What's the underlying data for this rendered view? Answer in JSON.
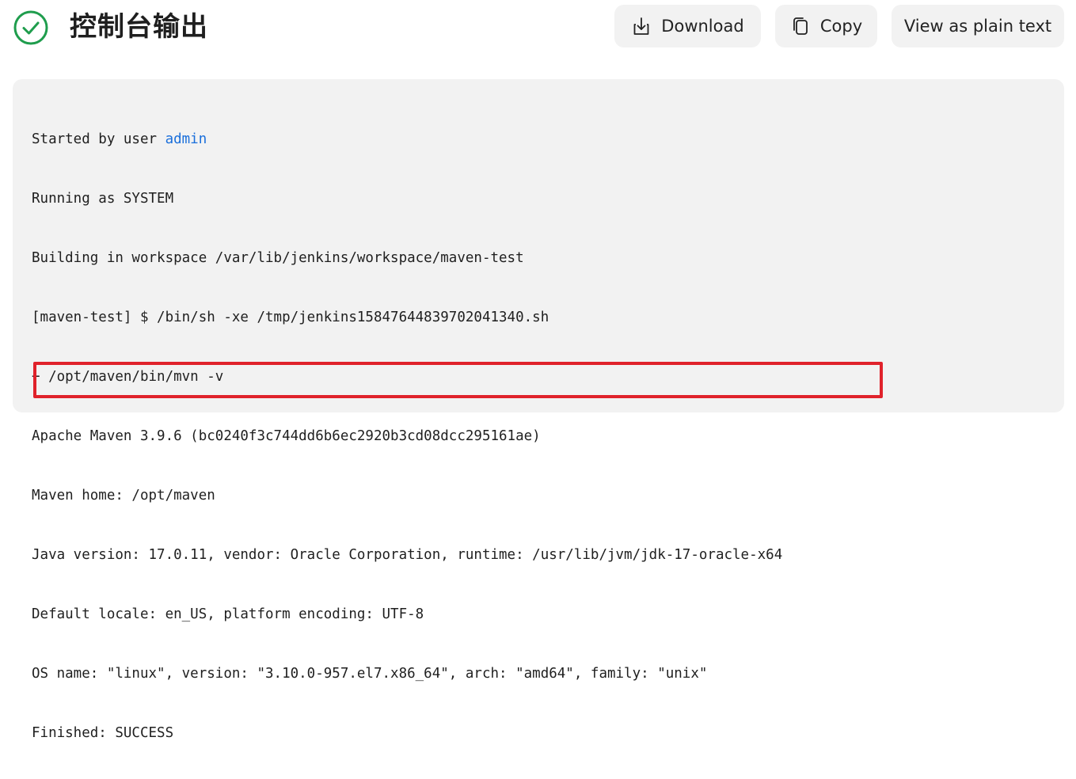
{
  "header": {
    "title": "控制台输出",
    "status_icon": "check-circle-icon",
    "status_color": "#1f9d4d"
  },
  "toolbar": {
    "download_label": "Download",
    "download_icon": "download-icon",
    "copy_label": "Copy",
    "copy_icon": "copy-icon",
    "plain_text_label": "View as plain text"
  },
  "console": {
    "line1_prefix": "Started by user ",
    "line1_user": "admin",
    "lines": [
      "Running as SYSTEM",
      "Building in workspace /var/lib/jenkins/workspace/maven-test",
      "[maven-test] $ /bin/sh -xe /tmp/jenkins15847644839702041340.sh",
      "+ /opt/maven/bin/mvn -v",
      "Apache Maven 3.9.6 (bc0240f3c744dd6b6ec2920b3cd08dcc295161ae)",
      "Maven home: /opt/maven",
      "Java version: 17.0.11, vendor: Oracle Corporation, runtime: /usr/lib/jvm/jdk-17-oracle-x64",
      "Default locale: en_US, platform encoding: UTF-8",
      "OS name: \"linux\", version: \"3.10.0-957.el7.x86_64\", arch: \"amd64\", family: \"unix\"",
      "Finished: SUCCESS"
    ],
    "link_color": "#1a6fdb",
    "highlight_color": "#e0222b"
  }
}
